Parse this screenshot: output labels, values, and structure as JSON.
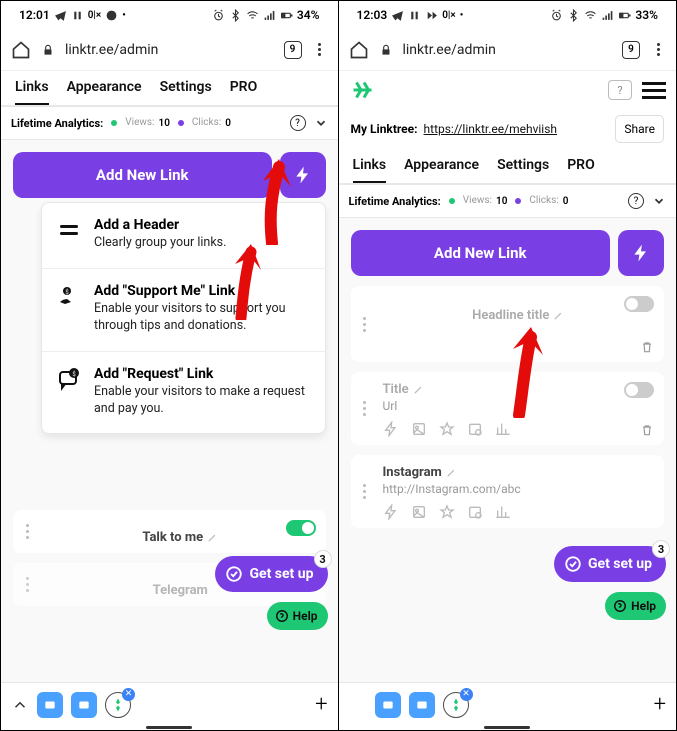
{
  "left": {
    "status": {
      "time": "12:01",
      "battery": "34%"
    },
    "browser": {
      "url": "linktr.ee/admin",
      "tabs": "9"
    },
    "tabs": [
      "Links",
      "Appearance",
      "Settings",
      "PRO"
    ],
    "analytics": {
      "label": "Lifetime Analytics:",
      "views_label": "Views:",
      "views": "10",
      "clicks_label": "Clicks:",
      "clicks": "0"
    },
    "add_label": "Add New Link",
    "dropdown": [
      {
        "title": "Add a Header",
        "sub": "Clearly group your links."
      },
      {
        "title": "Add \"Support Me\" Link",
        "sub": "Enable your visitors to support you through tips and donations."
      },
      {
        "title": "Add \"Request\" Link",
        "sub": "Enable your visitors to make a request and pay you."
      }
    ],
    "link1_title": "Talk to me",
    "link2_title": "Telegram",
    "setup_label": "Get set up",
    "setup_badge": "3",
    "help_label": "Help"
  },
  "right": {
    "status": {
      "time": "12:03",
      "battery": "33%"
    },
    "browser": {
      "url": "linktr.ee/admin",
      "tabs": "9"
    },
    "mylinktree_label": "My Linktree:",
    "mylinktree_url": "https://linktr.ee/mehviish",
    "share_label": "Share",
    "tabs": [
      "Links",
      "Appearance",
      "Settings",
      "PRO"
    ],
    "analytics": {
      "label": "Lifetime Analytics:",
      "views_label": "Views:",
      "views": "10",
      "clicks_label": "Clicks:",
      "clicks": "0"
    },
    "add_label": "Add New Link",
    "card_headline": "Headline title",
    "card_title": "Title",
    "card_url": "Url",
    "card_ig_title": "Instagram",
    "card_ig_url": "http://Instagram.com/abc",
    "setup_label": "Get set up",
    "setup_badge": "3",
    "help_label": "Help"
  }
}
